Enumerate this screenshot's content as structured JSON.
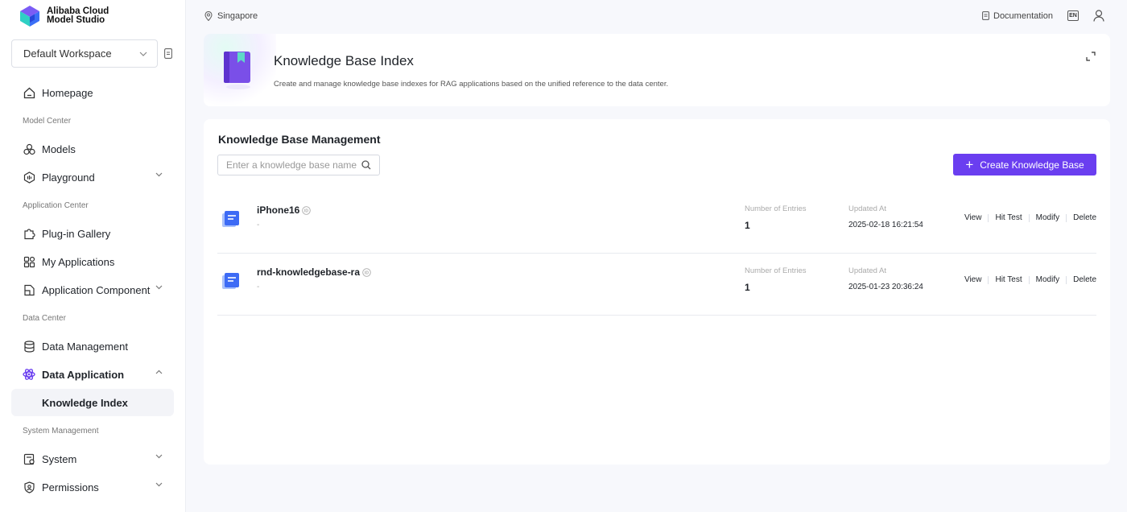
{
  "brand": {
    "line1": "Alibaba Cloud",
    "line2": "Model Studio"
  },
  "workspace": {
    "selected": "Default Workspace"
  },
  "sidebar": {
    "homepage": "Homepage",
    "model_center": {
      "label": "Model Center",
      "items": [
        "Models",
        "Playground"
      ]
    },
    "application_center": {
      "label": "Application Center",
      "items": [
        "Plug-in Gallery",
        "My Applications",
        "Application Component"
      ]
    },
    "data_center": {
      "label": "Data Center",
      "items": [
        "Data Management",
        "Data Application"
      ],
      "sub_items": [
        "Knowledge Index"
      ]
    },
    "system_management": {
      "label": "System Management",
      "items": [
        "System",
        "Permissions"
      ]
    }
  },
  "topbar": {
    "region": "Singapore",
    "documentation": "Documentation",
    "language": "EN"
  },
  "header": {
    "title": "Knowledge Base Index",
    "description": "Create and manage knowledge base indexes for RAG applications based on the unified reference to the data center."
  },
  "management": {
    "title": "Knowledge Base Management",
    "search_placeholder": "Enter a knowledge base name",
    "create_label": "Create Knowledge Base",
    "columns": {
      "entries": "Number of Entries",
      "updated": "Updated At"
    },
    "actions": [
      "View",
      "Hit Test",
      "Modify",
      "Delete"
    ],
    "rows": [
      {
        "name": "iPhone16",
        "description": "-",
        "entries": "1",
        "updated": "2025-02-18 16:21:54"
      },
      {
        "name": "rnd-knowledgebase-ra",
        "description": "-",
        "entries": "1",
        "updated": "2025-01-23 20:36:24"
      }
    ]
  },
  "colors": {
    "accent": "#6a3ef0",
    "kb_icon": "#3d6bf5",
    "active_icon": "#6a3ef0"
  }
}
